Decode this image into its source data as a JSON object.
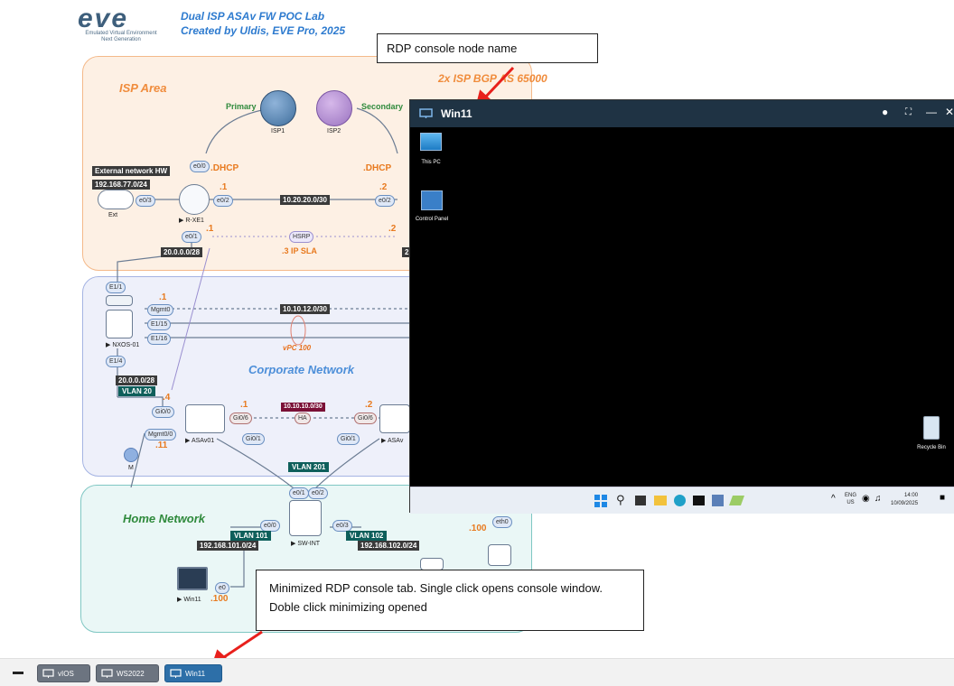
{
  "header": {
    "logo_text": "eve",
    "logo_sub1": "Emulated Virtual Environment",
    "logo_sub2": "Next Generation",
    "title_line1": "Dual ISP ASAv FW POC Lab",
    "title_line2": "Created by Uldis, EVE Pro, 2025"
  },
  "topology": {
    "isp_area": "ISP Area",
    "bgp_label": "2x ISP BGP AS 65000",
    "primary": "Primary",
    "secondary": "Secondary",
    "isp1": "ISP1",
    "isp2": "ISP2",
    "dhcp_left": ".DHCP",
    "dhcp_right": ".DHCP",
    "ext_hw": "External network HW",
    "ext_net": "192.168.77.0/24",
    "ext_node": "Ext",
    "rxe1": "R-XE1",
    "rxe1_e00": "e0/0",
    "rxe1_e03": "e0/3",
    "rxe1_e02": "e0/2",
    "rxe1_e01": "e0/1",
    "rxe2_e02": "e0/2",
    "dot1": ".1",
    "dot2": ".2",
    "link_net": "10.20.20.0/30",
    "hsrp": "HSRP",
    "ip_sla": ".3 IP SLA",
    "net_20": "20.0.0.0/28",
    "net_20_right": "2",
    "corp_area": "Corporate Network",
    "nxos": "NXOS-01",
    "e11": "E1/1",
    "mgmt0": "Mgmt0",
    "e115": "E1/15",
    "e116": "E1/16",
    "e14": "E1/4",
    "nx_dot1": ".1",
    "net_1010": "10.10.12.0/30",
    "vpc": "vPC 100",
    "net_20b": "20.0.0.0/28",
    "vlan20": "VLAN 20",
    "dot4": ".4",
    "gi00": "Gi0/0",
    "mgmt00": "Mgmt0/0",
    "dot11": ".11",
    "m_node": "M",
    "asa1": "ASAv01",
    "asa2": "ASAv",
    "gi06_left": "Gi0/6",
    "gi06_right": "Gi0/6",
    "gi01_left": "Gi0/1",
    "gi01_right": "Gi0/1",
    "ha_net": "10.10.10.0/30",
    "ha": "HA",
    "asa_dot1": ".1",
    "asa_dot2": ".2",
    "vlan201": "VLAN 201",
    "home_area": "Home Network",
    "swint": "SW-INT",
    "sw_e01": "e0/1",
    "sw_e02": "e0/2",
    "sw_e00": "e0/0",
    "sw_e03": "e0/3",
    "vlan101": "VLAN 101",
    "net101": "192.168.101.0/24",
    "vlan102": "VLAN 102",
    "net102": "192.168.102.0/24",
    "win11_node": "Win11",
    "win11_ip": ".100",
    "win11_e0": "e0",
    "docker_ip": ".100",
    "docker_eth": "eth0"
  },
  "rdp_window": {
    "title": "Win11",
    "desktop_icons": [
      "This PC",
      "Control Panel",
      "Recycle Bin"
    ],
    "tray": {
      "lang1": "ENG",
      "lang2": "US",
      "time": "14:00",
      "date": "10/09/2025"
    }
  },
  "callouts": {
    "top": "RDP console node name",
    "bottom": "Minimized RDP console tab. Single click opens console window. Doble click minimizing opened"
  },
  "bottombar": {
    "tabs": [
      {
        "label": "vIOS",
        "active": false
      },
      {
        "label": "WS2022",
        "active": false
      },
      {
        "label": "Win11",
        "active": true
      }
    ]
  },
  "colors": {
    "isp_area": "#fdf0e4",
    "corp_area": "#eef0fa",
    "home_area": "#eaf7f6",
    "rdp_titlebar": "#1f3344",
    "active_tab": "#2d6fa8",
    "annotation_arrow": "#e8201c"
  }
}
